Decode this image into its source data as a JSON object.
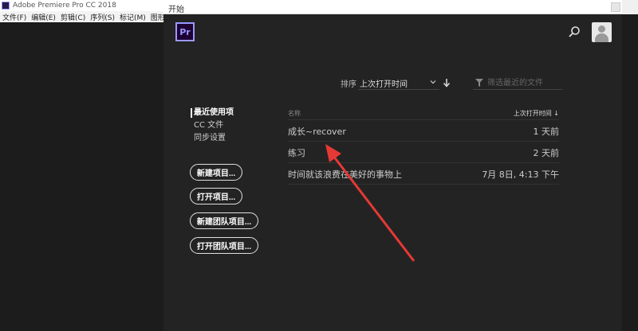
{
  "app": {
    "title": "Adobe Premiere Pro CC 2018",
    "menu": [
      "文件(F)",
      "编辑(E)",
      "剪辑(C)",
      "序列(S)",
      "标记(M)",
      "图形(G)"
    ]
  },
  "dialog": {
    "title": "开始",
    "logo_text": "Pr"
  },
  "sort": {
    "label": "排序",
    "value": "上次打开时间"
  },
  "filter": {
    "placeholder": "筛选最近的文件"
  },
  "nav": {
    "items": [
      {
        "label": "最近使用项",
        "active": true
      },
      {
        "label": "CC 文件",
        "active": false
      },
      {
        "label": "同步设置",
        "active": false
      }
    ]
  },
  "buttons": {
    "new_project": "新建项目...",
    "open_project": "打开项目...",
    "new_team_project": "新建团队项目...",
    "open_team_project": "打开团队项目..."
  },
  "table": {
    "col_name": "名称",
    "col_date": "上次打开时间",
    "rows": [
      {
        "name": "成长~recover",
        "date": "1 天前"
      },
      {
        "name": "练习",
        "date": "2 天前"
      },
      {
        "name": "时间就该浪费在美好的事物上",
        "date": "7月 8日, 4:13 下午"
      }
    ]
  },
  "colors": {
    "accent": "#9999ff",
    "annotation_arrow": "#e53935"
  }
}
